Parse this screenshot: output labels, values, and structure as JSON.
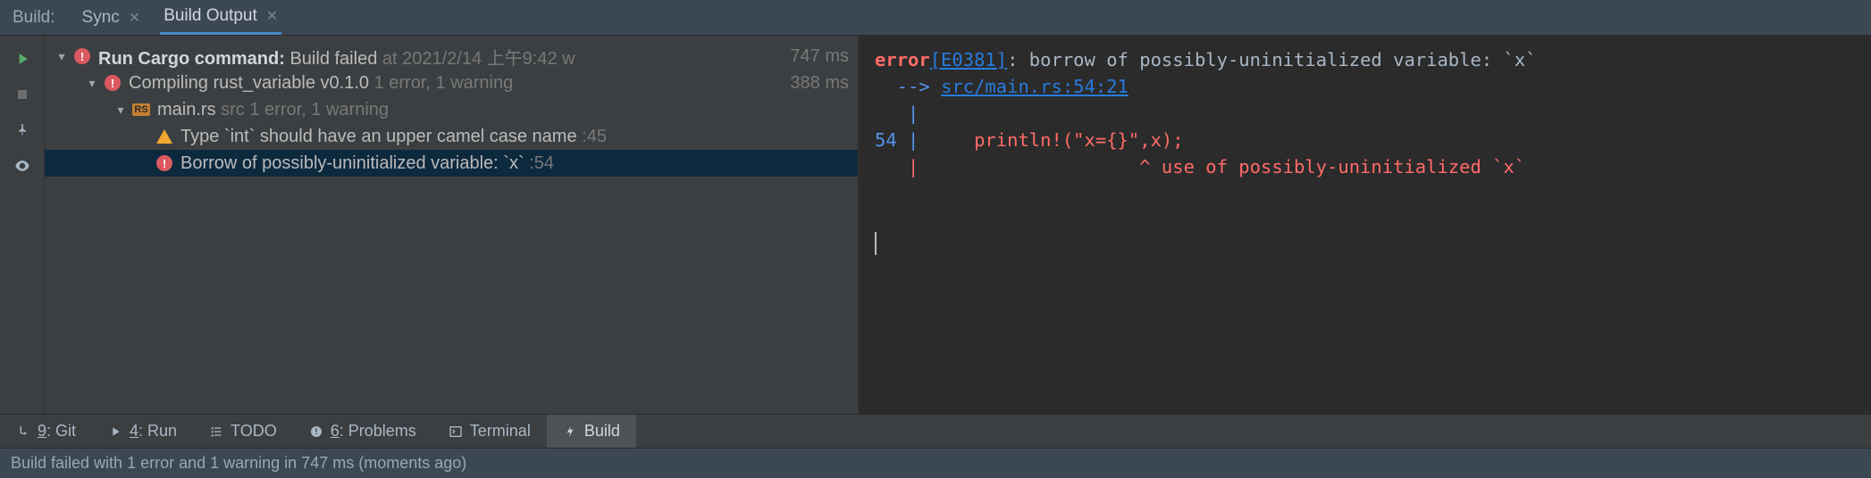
{
  "tabstrip": {
    "label": "Build:",
    "tabs": [
      {
        "label": "Sync",
        "active": false
      },
      {
        "label": "Build Output",
        "active": true
      }
    ]
  },
  "tree": {
    "root": {
      "title_prefix": "Run Cargo command:",
      "title_status": "Build failed",
      "timestamp": "at 2021/2/14 上午9:42 w",
      "duration": "747 ms"
    },
    "compile": {
      "label": "Compiling rust_variable v0.1.0",
      "summary": "1 error, 1 warning",
      "duration": "388 ms"
    },
    "file": {
      "name": "main.rs",
      "path_hint": "src",
      "summary": "1 error, 1 warning"
    },
    "diagnostics": [
      {
        "kind": "warning",
        "text": "Type `int` should have an upper camel case name",
        "loc": ":45"
      },
      {
        "kind": "error",
        "text": "Borrow of possibly-uninitialized variable: `x`",
        "loc": ":54"
      }
    ]
  },
  "output": {
    "error_label": "error",
    "error_code": "[E0381]",
    "error_msg": ": borrow of possibly-uninitialized variable: `x`",
    "arrow_prefix": "  --> ",
    "file_link": "src/main.rs:54:21",
    "pipe": "   |",
    "line_no": "54",
    "line_sep": " |     ",
    "code_line": "println!(\"x={}\",x);",
    "caret_line": "   |                    ^ use of possibly-uninitialized `x`"
  },
  "bottom_tabs": [
    {
      "icon": "git",
      "label_pre": "9",
      "label": ": Git"
    },
    {
      "icon": "run",
      "label_pre": "4",
      "label": ": Run"
    },
    {
      "icon": "todo",
      "label_pre": "",
      "label": "TODO"
    },
    {
      "icon": "problems",
      "label_pre": "6",
      "label": ": Problems"
    },
    {
      "icon": "terminal",
      "label_pre": "",
      "label": "Terminal"
    },
    {
      "icon": "build",
      "label_pre": "",
      "label": "Build",
      "active": true
    }
  ],
  "status_bar": "Build failed with 1 error and 1 warning in 747 ms (moments ago)"
}
